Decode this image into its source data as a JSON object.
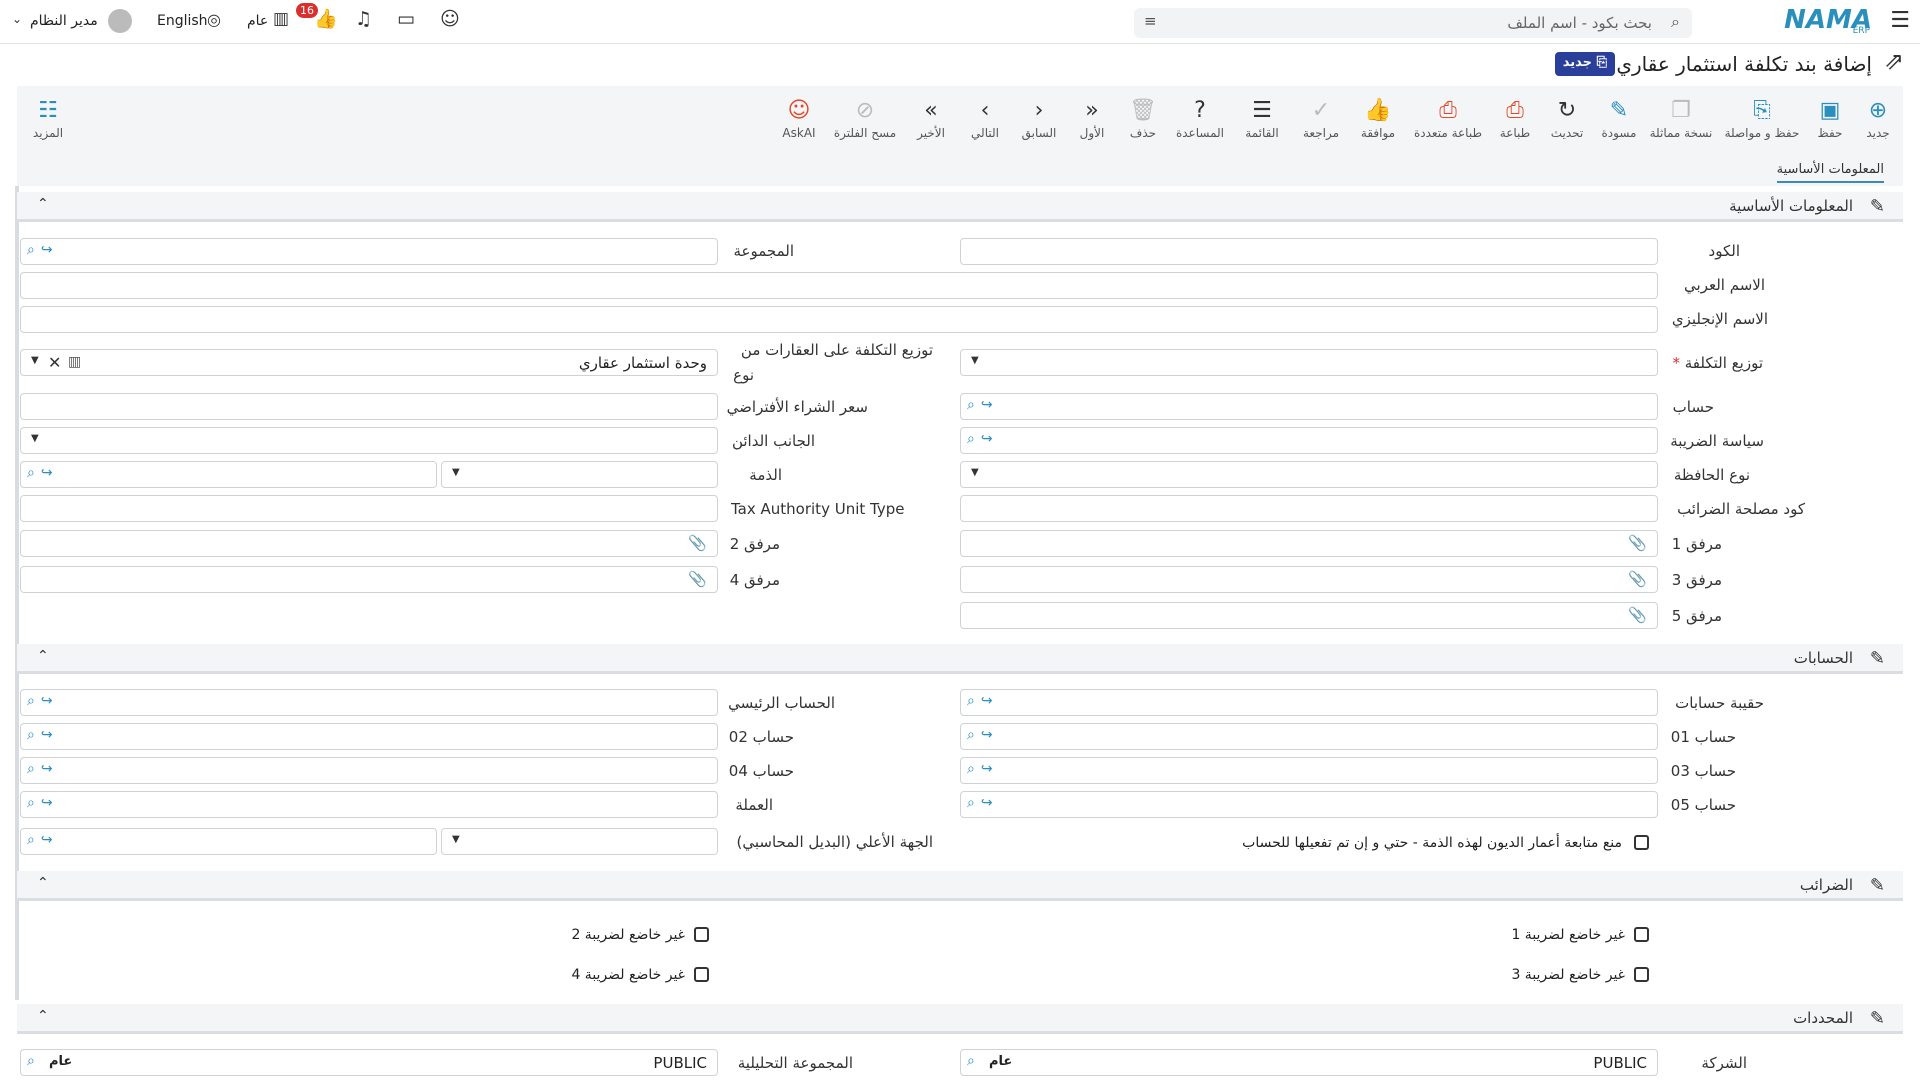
{
  "topbar": {
    "user": "مدير النظام",
    "language": "English",
    "public_label": "عام",
    "notif_count": "16",
    "search_placeholder": "بحث بكود - اسم الملف",
    "logo_text": "NAMA",
    "logo_sub": "ERP"
  },
  "page": {
    "title": "إضافة بند تكلفة استثمار عقاري",
    "new_badge": "جديد"
  },
  "toolbar": {
    "new": "جديد",
    "save": "حفظ",
    "save_continue": "حفظ و مواصلة",
    "clone": "نسخة مماثلة",
    "draft": "مسودة",
    "refresh": "تحديث",
    "print": "طباعة",
    "multi_print": "طباعة متعددة",
    "approve": "موافقة",
    "review": "مراجعة",
    "list": "القائمة",
    "help": "المساعدة",
    "delete": "حذف",
    "first": "الأول",
    "prev": "السابق",
    "next": "التالي",
    "last": "الأخير",
    "clear_filter": "مسح الفلترة",
    "askai": "AskAI",
    "more": "المزيد"
  },
  "tabs": {
    "basic": "المعلومات الأساسية"
  },
  "sections": {
    "basic": "المعلومات الأساسية",
    "accounts": "الحسابات",
    "taxes": "الضرائب",
    "dimensions": "المحددات"
  },
  "fields": {
    "code": "الكود",
    "group": "المجموعة",
    "arabic_name": "الاسم العربي",
    "english_name": "الاسم الإنجليزي",
    "cost_distribution": "توزيع التكلفة",
    "distribute_on_type_l1": "توزيع التكلفة على العقارات من",
    "distribute_on_type_l2": "نوع",
    "distribute_on_type_value": "وحدة استثمار عقاري",
    "account": "حساب",
    "default_purchase_price": "سعر الشراء الأفتراضي",
    "tax_policy": "سياسة الضريبة",
    "credit_side": "الجانب الدائن",
    "portfolio_type": "نوع الحافظة",
    "subsidiary": "الذمة",
    "tax_authority_code": "كود مصلحة الضرائب",
    "tax_authority_unit_type": "Tax Authority Unit Type",
    "attachment1": "مرفق 1",
    "attachment2": "مرفق 2",
    "attachment3": "مرفق 3",
    "attachment4": "مرفق 4",
    "attachment5": "مرفق 5",
    "account_bag": "حقيبة حسابات",
    "main_account": "الحساب الرئيسي",
    "account01": "حساب 01",
    "account02": "حساب 02",
    "account03": "حساب 03",
    "account04": "حساب 04",
    "account05": "حساب 05",
    "currency": "العملة",
    "prevent_debt_aging": "منع متابعة أعمار الديون لهذه الذمة - حتي و إن تم تفعيلها للحساب",
    "higher_entity": "الجهة الأعلي (البديل المحاسبي)",
    "not_taxable1": "غير خاضع لضريبة 1",
    "not_taxable2": "غير خاضع لضريبة 2",
    "not_taxable3": "غير خاضع لضريبة 3",
    "not_taxable4": "غير خاضع لضريبة 4",
    "company": "الشركة",
    "company_value": "PUBLIC",
    "company_tag": "عام",
    "analytic_group": "المجموعة التحليلية",
    "analytic_group_value": "PUBLIC",
    "analytic_group_tag": "عام"
  },
  "colors": {
    "accent": "#2a8fbd",
    "badge": "#2a3f9a",
    "danger": "#e04a2a",
    "notif": "#d9302e"
  }
}
